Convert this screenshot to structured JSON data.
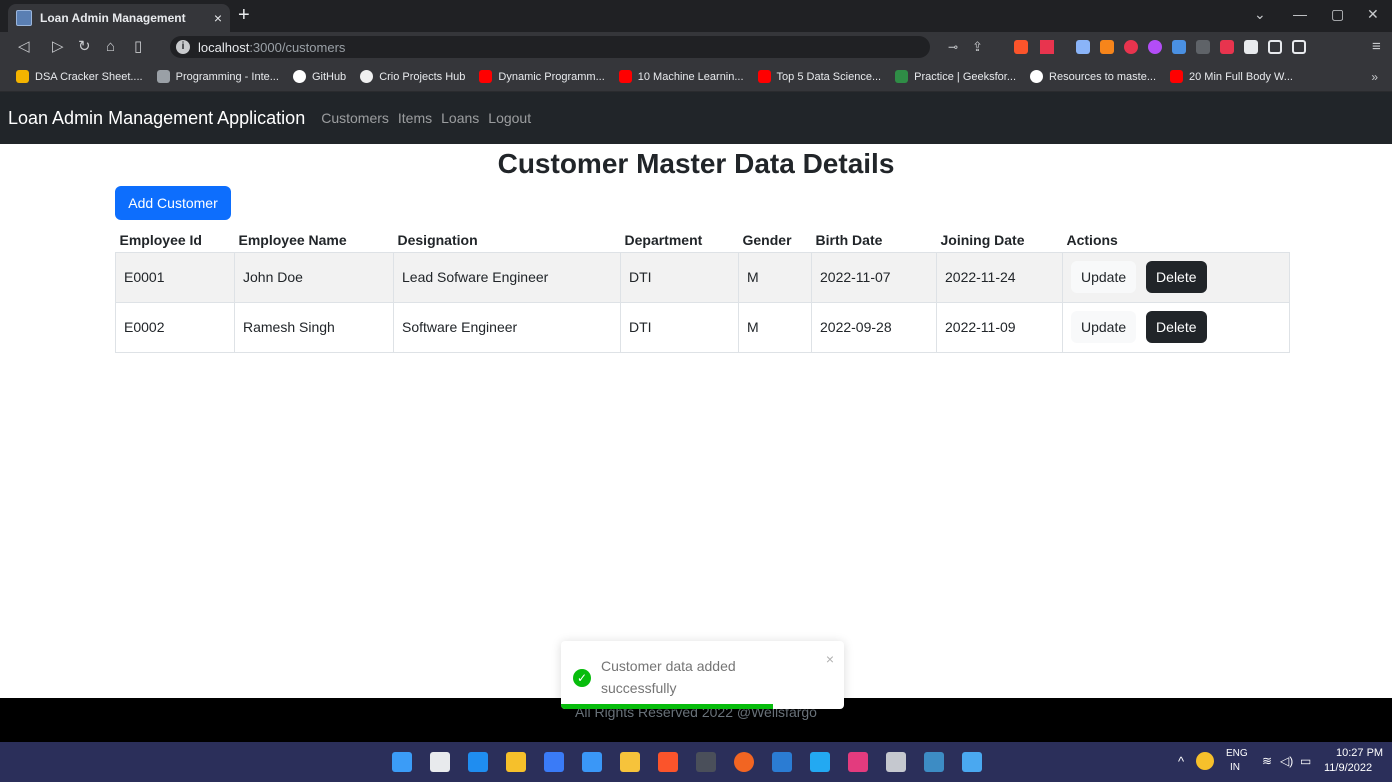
{
  "browser": {
    "tab_title": "Loan Admin Management",
    "tab_close": "×",
    "new_tab": "+",
    "url_host": "localhost",
    "url_path": ":3000/customers",
    "bookmarks": [
      {
        "label": "DSA Cracker Sheet....",
        "color": "#f4b400"
      },
      {
        "label": "Programming - Inte...",
        "color": "#e8eaed"
      },
      {
        "label": "GitHub",
        "color": "#ffffff"
      },
      {
        "label": "Crio Projects Hub",
        "color": "#f0f0f0"
      },
      {
        "label": "Dynamic Programm...",
        "color": "#ff0000"
      },
      {
        "label": "10 Machine Learnin...",
        "color": "#ff0000"
      },
      {
        "label": "Top 5 Data Science...",
        "color": "#ff0000"
      },
      {
        "label": "Practice | Geeksfor...",
        "color": "#2f8d46"
      },
      {
        "label": "Resources to maste...",
        "color": "#ffffff"
      },
      {
        "label": "20 Min Full Body W...",
        "color": "#ff0000"
      }
    ],
    "bookmarks_more": "»"
  },
  "navbar": {
    "brand": "Loan Admin Management Application",
    "links": [
      "Customers",
      "Items",
      "Loans",
      "Logout"
    ]
  },
  "page": {
    "title": "Customer Master Data Details",
    "add_button": "Add Customer"
  },
  "table": {
    "headers": [
      "Employee Id",
      "Employee Name",
      "Designation",
      "Department",
      "Gender",
      "Birth Date",
      "Joining Date",
      "Actions"
    ],
    "rows": [
      {
        "id": "E0001",
        "name": "John Doe",
        "designation": "Lead Sofware Engineer",
        "department": "DTI",
        "gender": "M",
        "birth": "2022-11-07",
        "joining": "2022-11-24"
      },
      {
        "id": "E0002",
        "name": "Ramesh Singh",
        "designation": "Software Engineer",
        "department": "DTI",
        "gender": "M",
        "birth": "2022-09-28",
        "joining": "2022-11-09"
      }
    ],
    "update_label": "Update",
    "delete_label": "Delete"
  },
  "footer": {
    "text": "All Rights Reserved 2022 @Wellsfargo"
  },
  "toast": {
    "message": "Customer data added successfully",
    "close": "×",
    "progress": 0.75
  },
  "taskbar": {
    "lang_top": "ENG",
    "lang_bottom": "IN",
    "time": "10:27 PM",
    "date": "11/9/2022"
  }
}
